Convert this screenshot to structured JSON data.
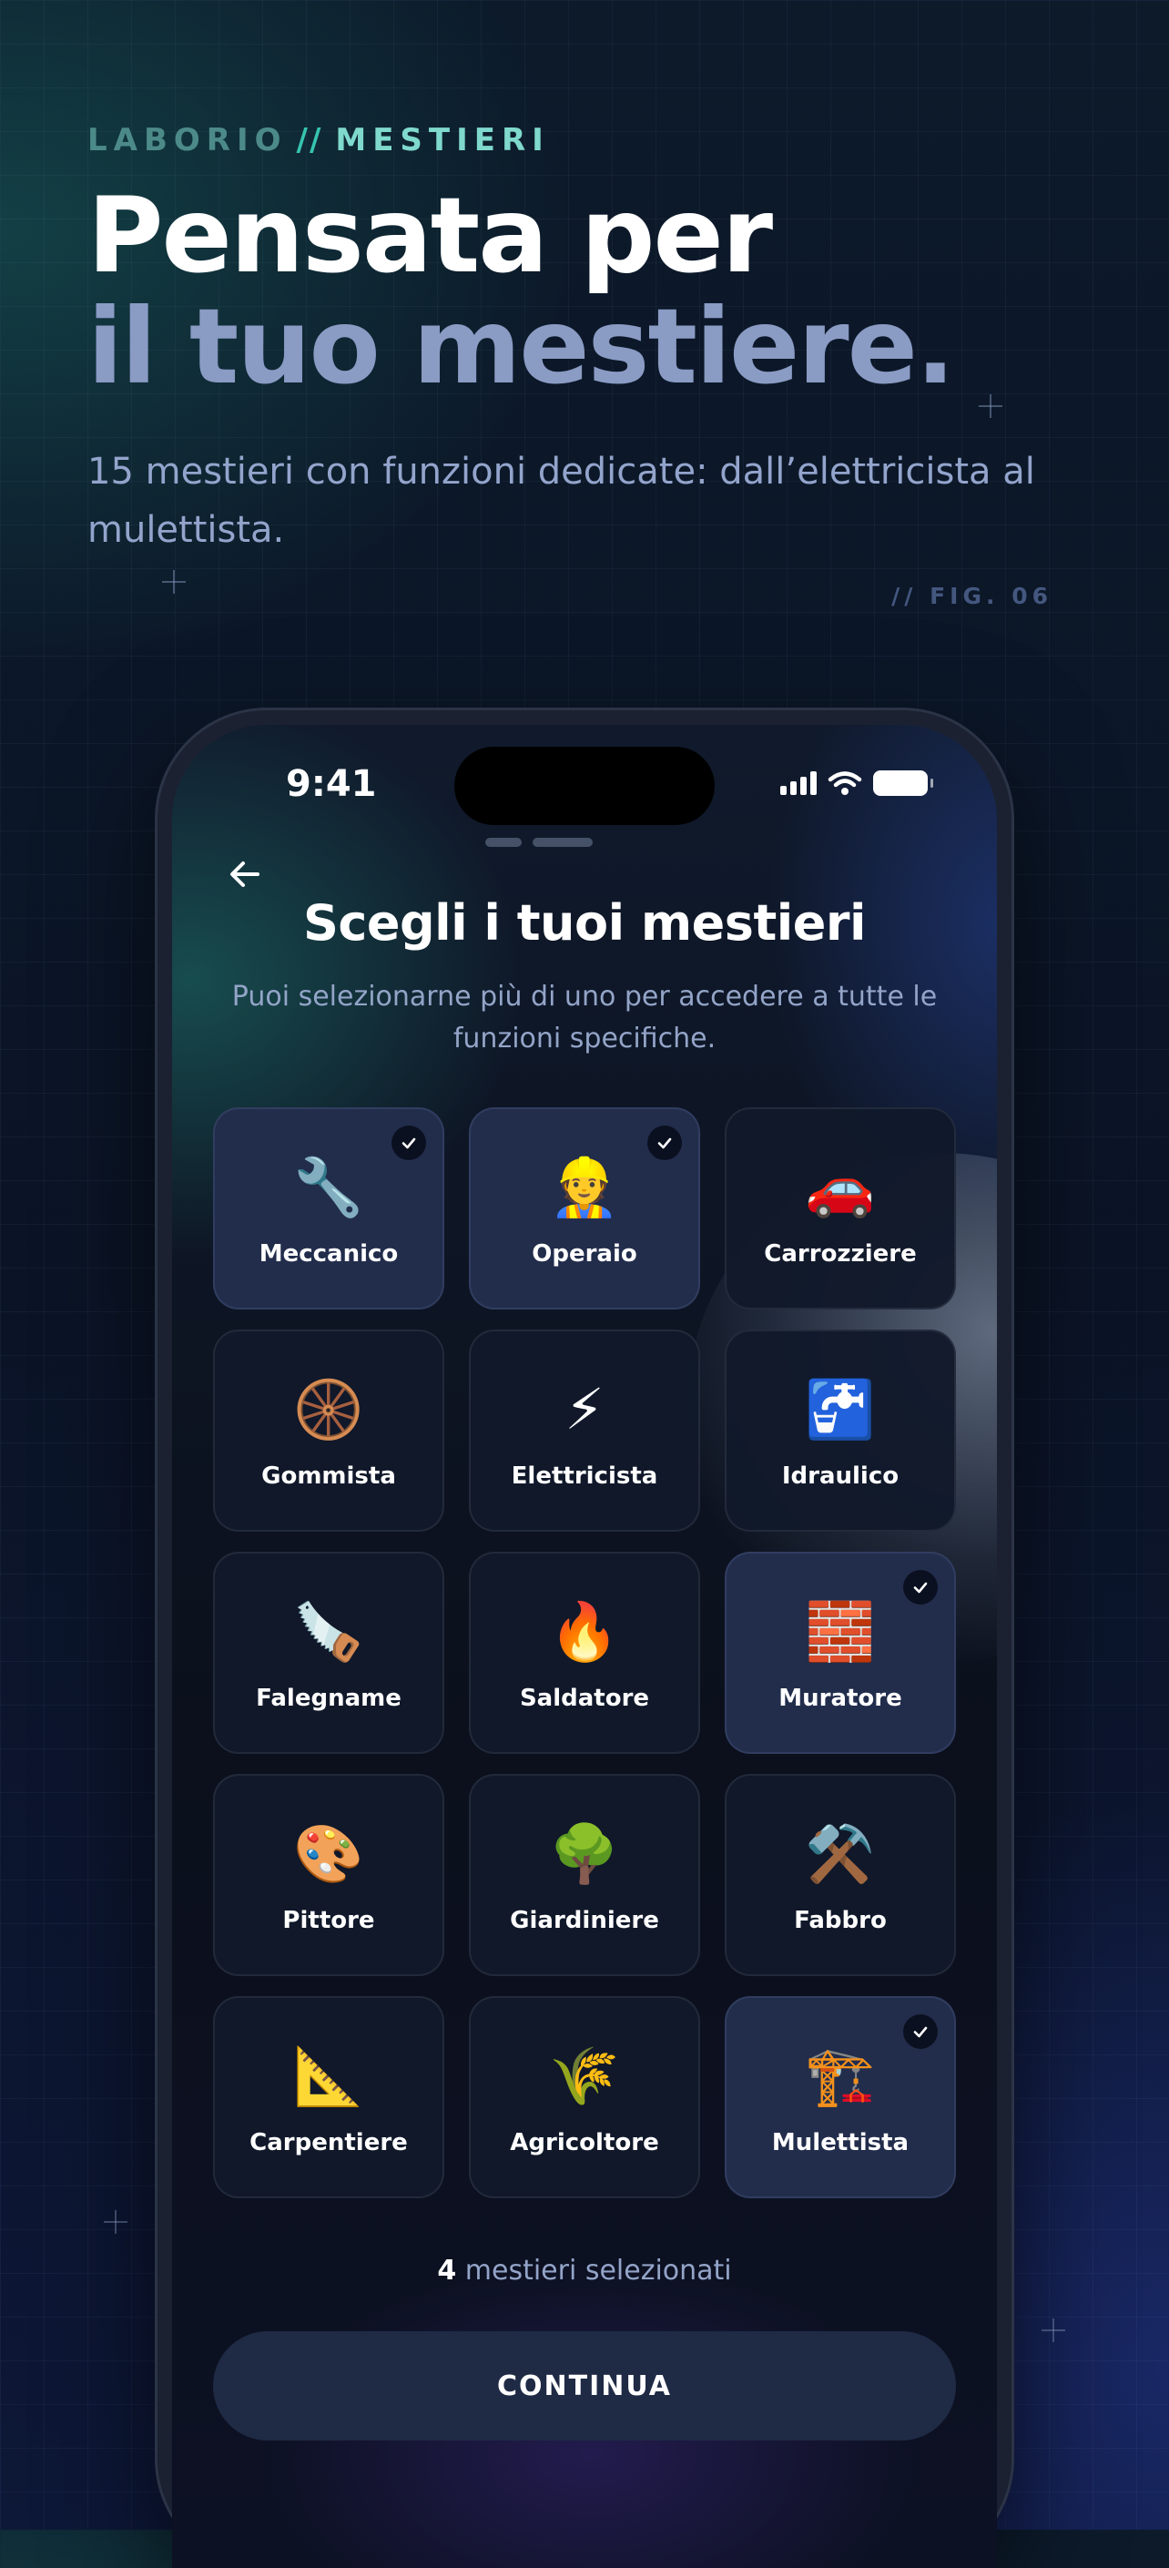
{
  "page": {
    "eyebrow": {
      "brand": "LABORIO",
      "separator": "//",
      "section": "MESTIERI"
    },
    "headline": {
      "line1": "Pensata per",
      "line2": "il tuo mestiere."
    },
    "subtitle": "15 mestieri con funzioni dedicate: dall’elettricista al mulettista.",
    "figure_label": "// FIG. 06"
  },
  "status_bar": {
    "time": "9:41"
  },
  "screen": {
    "title": "Scegli i tuoi mestieri",
    "description": "Puoi selezionarne più di uno per accedere a tutte le funzioni specifiche.",
    "trades": [
      {
        "label": "Meccanico",
        "icon": "🔧",
        "icon_name": "wrench-icon",
        "selected": true
      },
      {
        "label": "Operaio",
        "icon": "👷",
        "icon_name": "construction-worker-icon",
        "selected": true
      },
      {
        "label": "Carrozziere",
        "icon": "🚗",
        "icon_name": "car-icon",
        "selected": false
      },
      {
        "label": "Gommista",
        "icon": "🛞",
        "icon_name": "tire-icon",
        "selected": false
      },
      {
        "label": "Elettricista",
        "icon": "⚡",
        "icon_name": "lightning-icon",
        "selected": false
      },
      {
        "label": "Idraulico",
        "icon": "🚰",
        "icon_name": "faucet-icon",
        "selected": false
      },
      {
        "label": "Falegname",
        "icon": "🪚",
        "icon_name": "saw-icon",
        "selected": false
      },
      {
        "label": "Saldatore",
        "icon": "🔥",
        "icon_name": "fire-icon",
        "selected": false
      },
      {
        "label": "Muratore",
        "icon": "🧱",
        "icon_name": "bricks-icon",
        "selected": true
      },
      {
        "label": "Pittore",
        "icon": "🎨",
        "icon_name": "palette-icon",
        "selected": false
      },
      {
        "label": "Giardiniere",
        "icon": "🌳",
        "icon_name": "tree-icon",
        "selected": false
      },
      {
        "label": "Fabbro",
        "icon": "⚒️",
        "icon_name": "hammer-pick-icon",
        "selected": false
      },
      {
        "label": "Carpentiere",
        "icon": "📐",
        "icon_name": "set-square-icon",
        "selected": false
      },
      {
        "label": "Agricoltore",
        "icon": "🌾",
        "icon_name": "wheat-icon",
        "selected": false
      },
      {
        "label": "Mulettista",
        "icon": "🏗️",
        "icon_name": "crane-icon",
        "selected": true
      }
    ],
    "selection_count": "4",
    "selection_text": "mestieri selezionati",
    "continue_label": "CONTINUA"
  },
  "colors": {
    "accent_teal": "#36c4b0",
    "headline_muted": "#8a9bc4",
    "tile_selected": "#222d4c",
    "tile_default": "#111a2b",
    "button_bg": "#1f2a45"
  }
}
